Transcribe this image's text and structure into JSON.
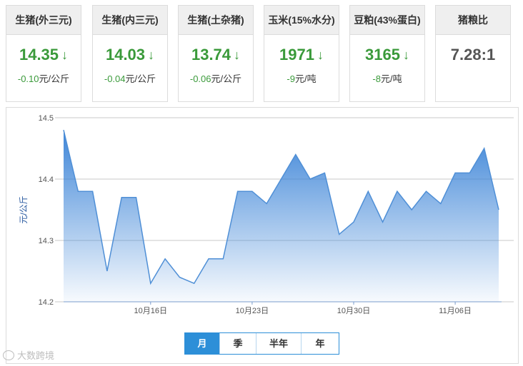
{
  "cards": [
    {
      "title": "生猪(外三元)",
      "price": "14.35",
      "change_num": "-0.10",
      "change_unit": "元/公斤"
    },
    {
      "title": "生猪(内三元)",
      "price": "14.03",
      "change_num": "-0.04",
      "change_unit": "元/公斤"
    },
    {
      "title": "生猪(土杂猪)",
      "price": "13.74",
      "change_num": "-0.06",
      "change_unit": "元/公斤"
    },
    {
      "title": "玉米(15%水分)",
      "price": "1971",
      "change_num": "-9",
      "change_unit": "元/吨"
    },
    {
      "title": "豆粕(43%蛋白)",
      "price": "3165",
      "change_num": "-8",
      "change_unit": "元/吨"
    },
    {
      "title": "猪粮比",
      "price": "7.28:1"
    }
  ],
  "colors": {
    "down": "#3a9a3a",
    "accent": "#2d8fd8",
    "line": "#4f8fd6"
  },
  "tabs": [
    "月",
    "季",
    "半年",
    "年"
  ],
  "active_tab": "月",
  "watermark": "大数跨境",
  "chart_data": {
    "type": "area",
    "ylabel": "元/公斤",
    "ylim": [
      14.2,
      14.5
    ],
    "yticks": [
      "14.5",
      "14.4",
      "14.3",
      "14.2"
    ],
    "xtick_labels": [
      "10月16日",
      "10月23日",
      "10月30日",
      "11月06日"
    ],
    "xtick_indices": [
      6,
      13,
      20,
      27
    ],
    "values": [
      14.48,
      14.38,
      14.38,
      14.25,
      14.37,
      14.37,
      14.23,
      14.27,
      14.24,
      14.23,
      14.27,
      14.27,
      14.38,
      14.38,
      14.36,
      14.4,
      14.44,
      14.4,
      14.41,
      14.31,
      14.33,
      14.38,
      14.33,
      14.38,
      14.35,
      14.38,
      14.36,
      14.41,
      14.41,
      14.45,
      14.35
    ],
    "grid": true
  }
}
